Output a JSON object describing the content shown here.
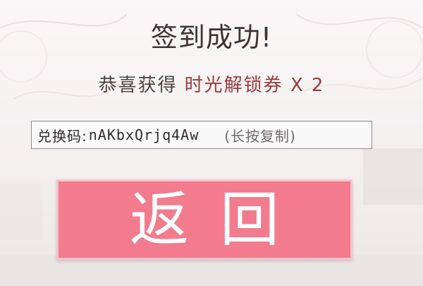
{
  "dialog": {
    "title": "签到成功!",
    "reward_prefix": "恭喜获得",
    "reward_item": "时光解锁券 X 2",
    "code_label": "兑换码:",
    "code_value": "nAKbxQrjq4Aw",
    "code_hint": "(长按复制)",
    "return_label": "返回"
  },
  "colors": {
    "button": "#f27b8e",
    "reward_item": "#9b3a3e",
    "title": "#3c3535"
  }
}
